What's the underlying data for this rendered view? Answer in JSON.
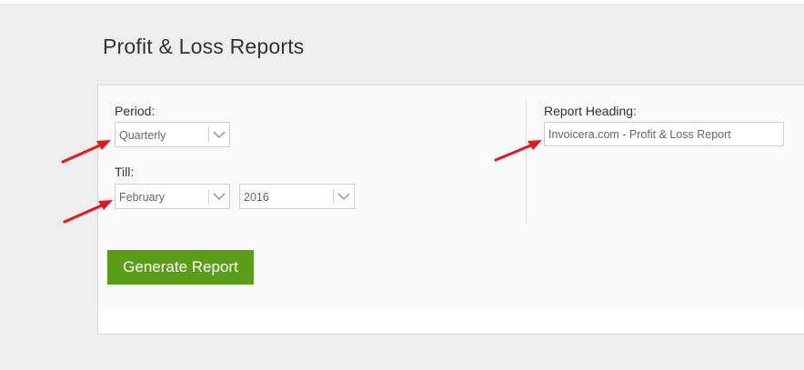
{
  "page": {
    "title": "Profit & Loss Reports"
  },
  "form": {
    "period_label": "Period:",
    "period_value": "Quarterly",
    "till_label": "Till:",
    "till_month_value": "February",
    "till_year_value": "2016",
    "report_heading_label": "Report Heading:",
    "report_heading_value": "Invoicera.com - Profit & Loss Report",
    "generate_button_label": "Generate Report"
  },
  "colors": {
    "primary_button": "#5a9e17",
    "annotation_arrow": "#e8151b"
  },
  "icons": {
    "select_chevron": "chevron-down-icon",
    "annotation": "red-arrow-icon"
  }
}
